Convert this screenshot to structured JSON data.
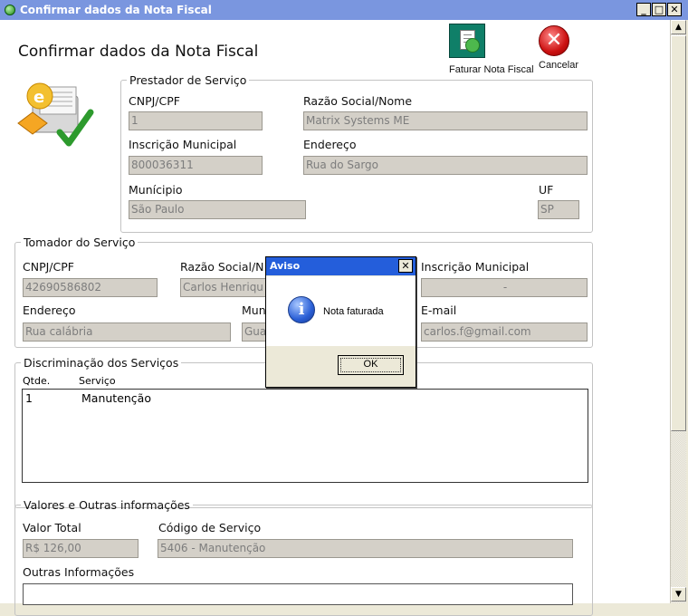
{
  "window": {
    "title": "Confirmar dados da Nota Fiscal",
    "minimize": "_",
    "maximize": "□",
    "close": "✕"
  },
  "header": {
    "title": "Confirmar dados da Nota Fiscal"
  },
  "toolbar": {
    "faturar_label": "Faturar Nota Fiscal",
    "cancelar_label": "Cancelar",
    "faturar_icon": "invoice-check-icon",
    "cancelar_icon": "cancel-icon"
  },
  "prestador": {
    "legend": "Prestador de Serviço",
    "cnpj_label": "CNPJ/CPF",
    "cnpj_value": "1",
    "razao_label": "Razão Social/Nome",
    "razao_value": "Matrix Systems ME",
    "inscricao_label": "Inscrição Municipal",
    "inscricao_value": "800036311",
    "endereco_label": "Endereço",
    "endereco_value": "Rua do Sargo",
    "municipio_label": "Munícipio",
    "municipio_value": "São Paulo",
    "uf_label": "UF",
    "uf_value": "SP"
  },
  "tomador": {
    "legend": "Tomador do Serviço",
    "cnpj_label": "CNPJ/CPF",
    "cnpj_value": "42690586802",
    "razao_label": "Razão Social/N",
    "razao_value": "Carlos Henriqu",
    "inscricao_label": "Inscrição Municipal",
    "inscricao_value": "-",
    "endereco_label": "Endereço",
    "endereco_value": "Rua calábria",
    "municipio_label": "Mun",
    "municipio_value": "Gua",
    "email_label": "E-mail",
    "email_value": "carlos.f@gmail.com"
  },
  "servicos": {
    "legend": "Discriminação dos Serviços",
    "col_qtde": "Qtde.",
    "col_servico": "Serviço",
    "rows": [
      {
        "qtde": "1",
        "servico": "Manutenção"
      }
    ]
  },
  "valores": {
    "legend": "Valores e Outras informações",
    "valor_label": "Valor Total",
    "valor_value": "R$ 126,00",
    "codigo_label": "Código de Serviço",
    "codigo_value": "5406 - Manutenção",
    "outras_label": "Outras Informações"
  },
  "dialog": {
    "title": "Aviso",
    "close": "✕",
    "message": "Nota faturada",
    "ok_label": "OK",
    "icon": "info-icon"
  },
  "scrollbar": {
    "up": "▲",
    "down": "▼"
  }
}
